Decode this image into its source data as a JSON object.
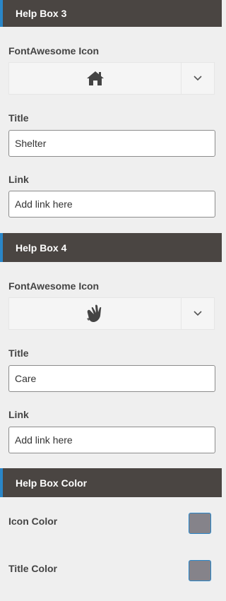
{
  "help_box_3": {
    "header": "Help Box 3",
    "icon_label": "FontAwesome Icon",
    "icon_name": "home-icon",
    "title_label": "Title",
    "title_value": "Shelter",
    "link_label": "Link",
    "link_placeholder": "Add link here"
  },
  "help_box_4": {
    "header": "Help Box 4",
    "icon_label": "FontAwesome Icon",
    "icon_name": "sign-language-icon",
    "title_label": "Title",
    "title_value": "Care",
    "link_label": "Link",
    "link_placeholder": "Add link here"
  },
  "help_box_color": {
    "header": "Help Box Color",
    "icon_color_label": "Icon Color",
    "icon_color_value": "#85838a",
    "title_color_label": "Title Color",
    "title_color_value": "#85838a"
  },
  "colors": {
    "header_bg": "#4a4542",
    "accent": "#2a86c8"
  }
}
